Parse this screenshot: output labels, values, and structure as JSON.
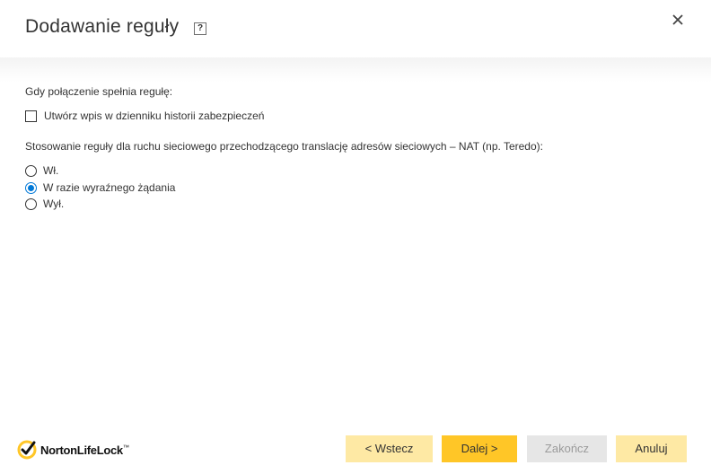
{
  "dialog": {
    "title": "Dodawanie reguły",
    "help_label": "?"
  },
  "logging_section": {
    "label": "Gdy połączenie spełnia regułę:",
    "checkbox_label": "Utwórz wpis w dzienniku historii zabezpieczeń",
    "checked": false
  },
  "nat_section": {
    "label": "Stosowanie reguły dla ruchu sieciowego przechodzącego translację adresów sieciowych – NAT (np. Teredo):",
    "options": [
      {
        "label": "Wł.",
        "selected": false
      },
      {
        "label": "W razie wyraźnego żądania",
        "selected": true
      },
      {
        "label": "Wył.",
        "selected": false
      }
    ]
  },
  "footer": {
    "logo_text": "NortonLifeLock",
    "logo_tm": "™",
    "back_label": "< Wstecz",
    "next_label": "Dalej >",
    "finish_label": "Zakończ",
    "cancel_label": "Anuluj"
  },
  "colors": {
    "accent_yellow": "#ffc627",
    "light_yellow": "#fee9a4",
    "radio_blue": "#0078d7",
    "disabled_gray": "#e6e6e6"
  }
}
